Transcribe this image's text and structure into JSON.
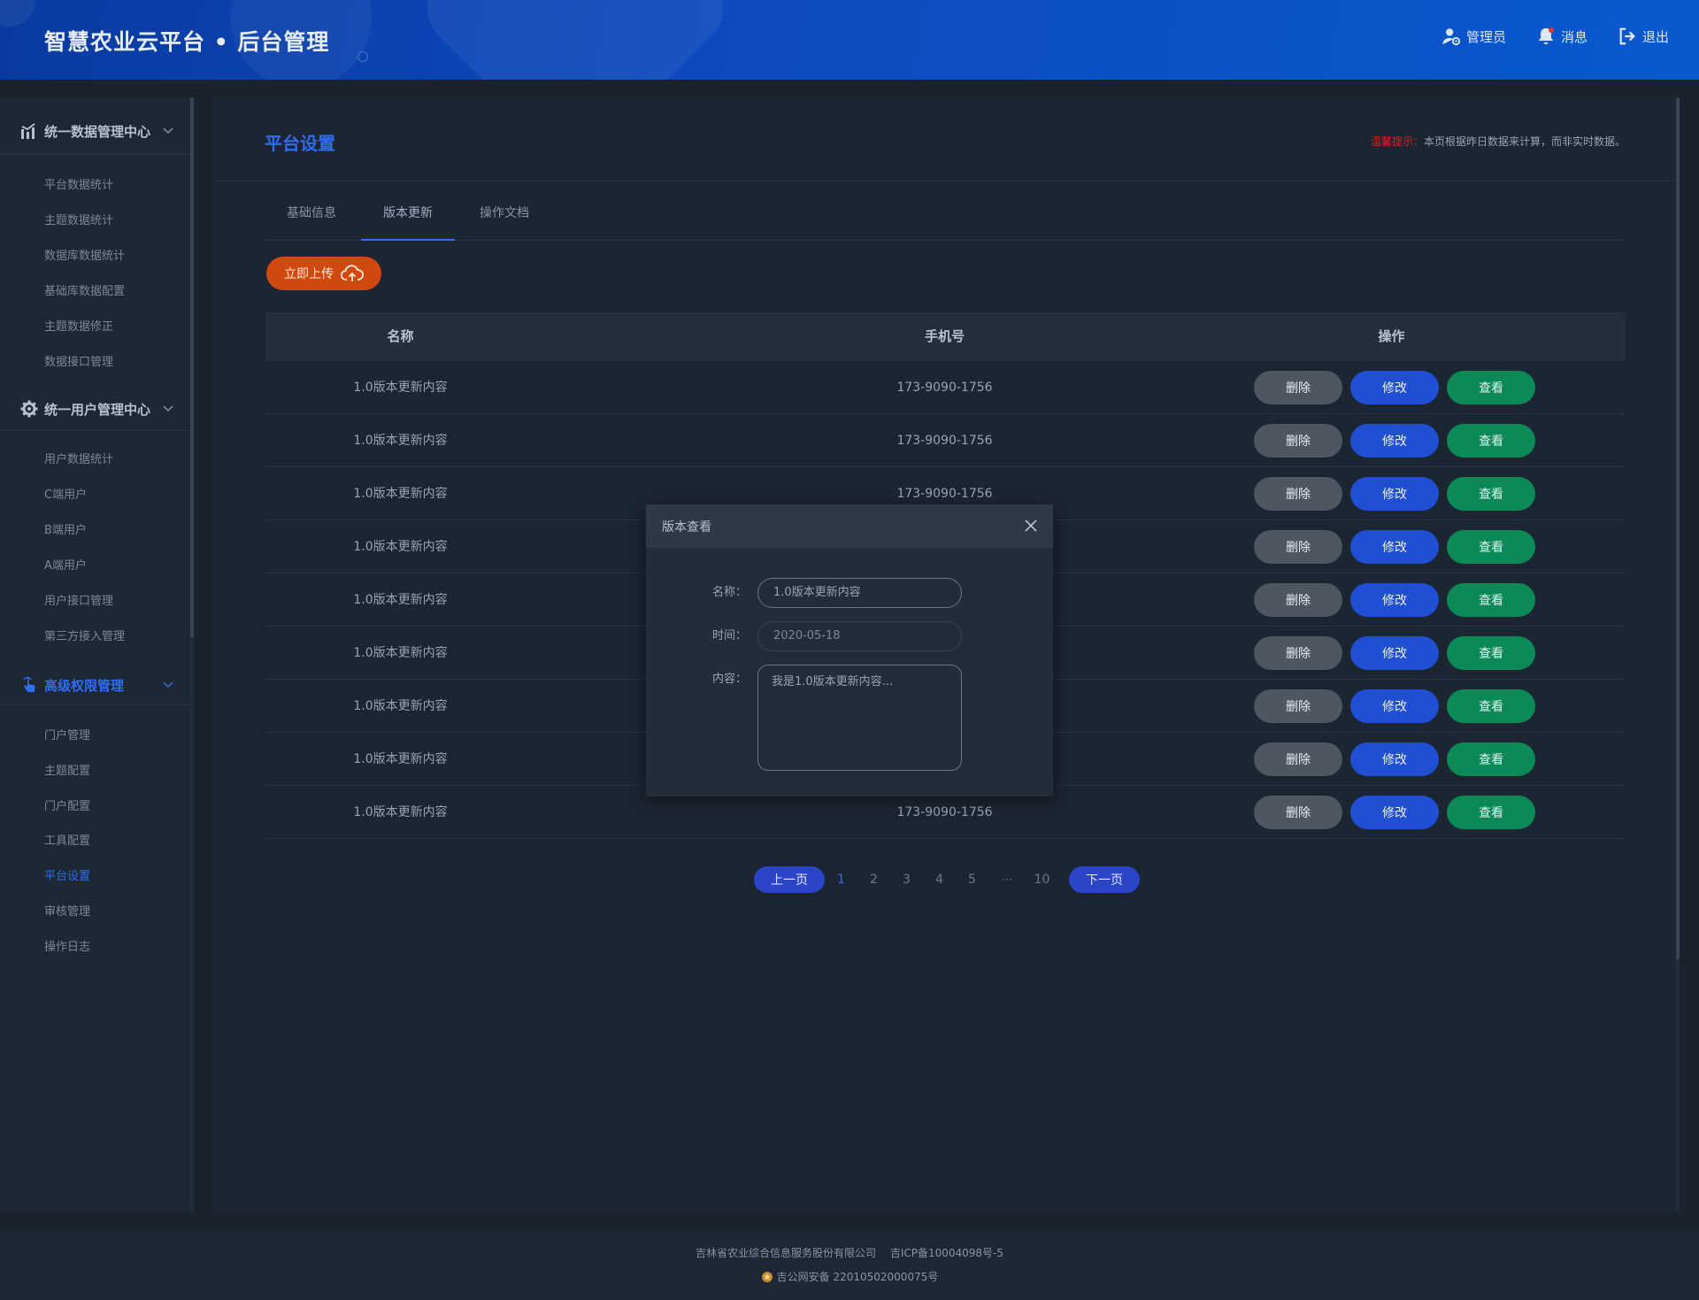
{
  "header": {
    "title": "智慧农业云平台 • 后台管理",
    "actions": {
      "admin": "管理员",
      "messages": "消息",
      "logout": "退出"
    }
  },
  "sidebar": {
    "groups": [
      {
        "label": "统一数据管理中心",
        "icon": "chart-icon",
        "items": [
          "平台数据统计",
          "主题数据统计",
          "数据库数据统计",
          "基础库数据配置",
          "主题数据修正",
          "数据接口管理"
        ]
      },
      {
        "label": "统一用户管理中心",
        "icon": "gear-icon",
        "items": [
          "用户数据统计",
          "C端用户",
          "B端用户",
          "A端用户",
          "用户接口管理",
          "第三方接入管理"
        ]
      },
      {
        "label": "高级权限管理",
        "icon": "pointer-icon",
        "items": [
          "门户管理",
          "主题配置",
          "门户配置",
          "工具配置",
          "平台设置",
          "审核管理",
          "操作日志"
        ]
      }
    ],
    "active_item": "平台设置"
  },
  "main": {
    "page_title": "平台设置",
    "notice": {
      "tag": "温馨提示：",
      "text": "本页根据昨日数据来计算，而非实时数据。"
    },
    "tabs": [
      "基础信息",
      "版本更新",
      "操作文档"
    ],
    "active_tab": "版本更新",
    "upload_label": "立即上传",
    "table": {
      "columns": [
        "名称",
        "手机号",
        "操作"
      ],
      "rows": [
        {
          "name": "1.0版本更新内容",
          "phone": "173-9090-1756"
        },
        {
          "name": "1.0版本更新内容",
          "phone": "173-9090-1756"
        },
        {
          "name": "1.0版本更新内容",
          "phone": "173-9090-1756"
        },
        {
          "name": "1.0版本更新内容",
          "phone": ""
        },
        {
          "name": "1.0版本更新内容",
          "phone": ""
        },
        {
          "name": "1.0版本更新内容",
          "phone": ""
        },
        {
          "name": "1.0版本更新内容",
          "phone": ""
        },
        {
          "name": "1.0版本更新内容",
          "phone": ""
        },
        {
          "name": "1.0版本更新内容",
          "phone": "173-9090-1756"
        }
      ],
      "ops": {
        "delete": "删除",
        "edit": "修改",
        "view": "查看"
      }
    },
    "pagination": {
      "prev": "上一页",
      "next": "下一页",
      "pages": [
        "1",
        "2",
        "3",
        "4",
        "5"
      ],
      "ellipsis": "···",
      "last": "10",
      "current": "1"
    }
  },
  "modal": {
    "title": "版本查看",
    "fields": {
      "name_label": "名称：",
      "name_value": "1.0版本更新内容",
      "time_label": "时间：",
      "time_value": "2020-05-18",
      "content_label": "内容：",
      "content_value": "我是1.0版本更新内容..."
    }
  },
  "footer": {
    "company": "吉林省农业综合信息服务股份有限公司",
    "icp": "吉ICP备10004098号-5",
    "police": "吉公网安备 22010502000075号"
  },
  "colors": {
    "accent": "#2f6df0",
    "upload": "#d2490f",
    "delete": "#4e5660",
    "edit": "#1f4fd2",
    "view": "#0b8a57",
    "notice_tag": "#e02020"
  }
}
